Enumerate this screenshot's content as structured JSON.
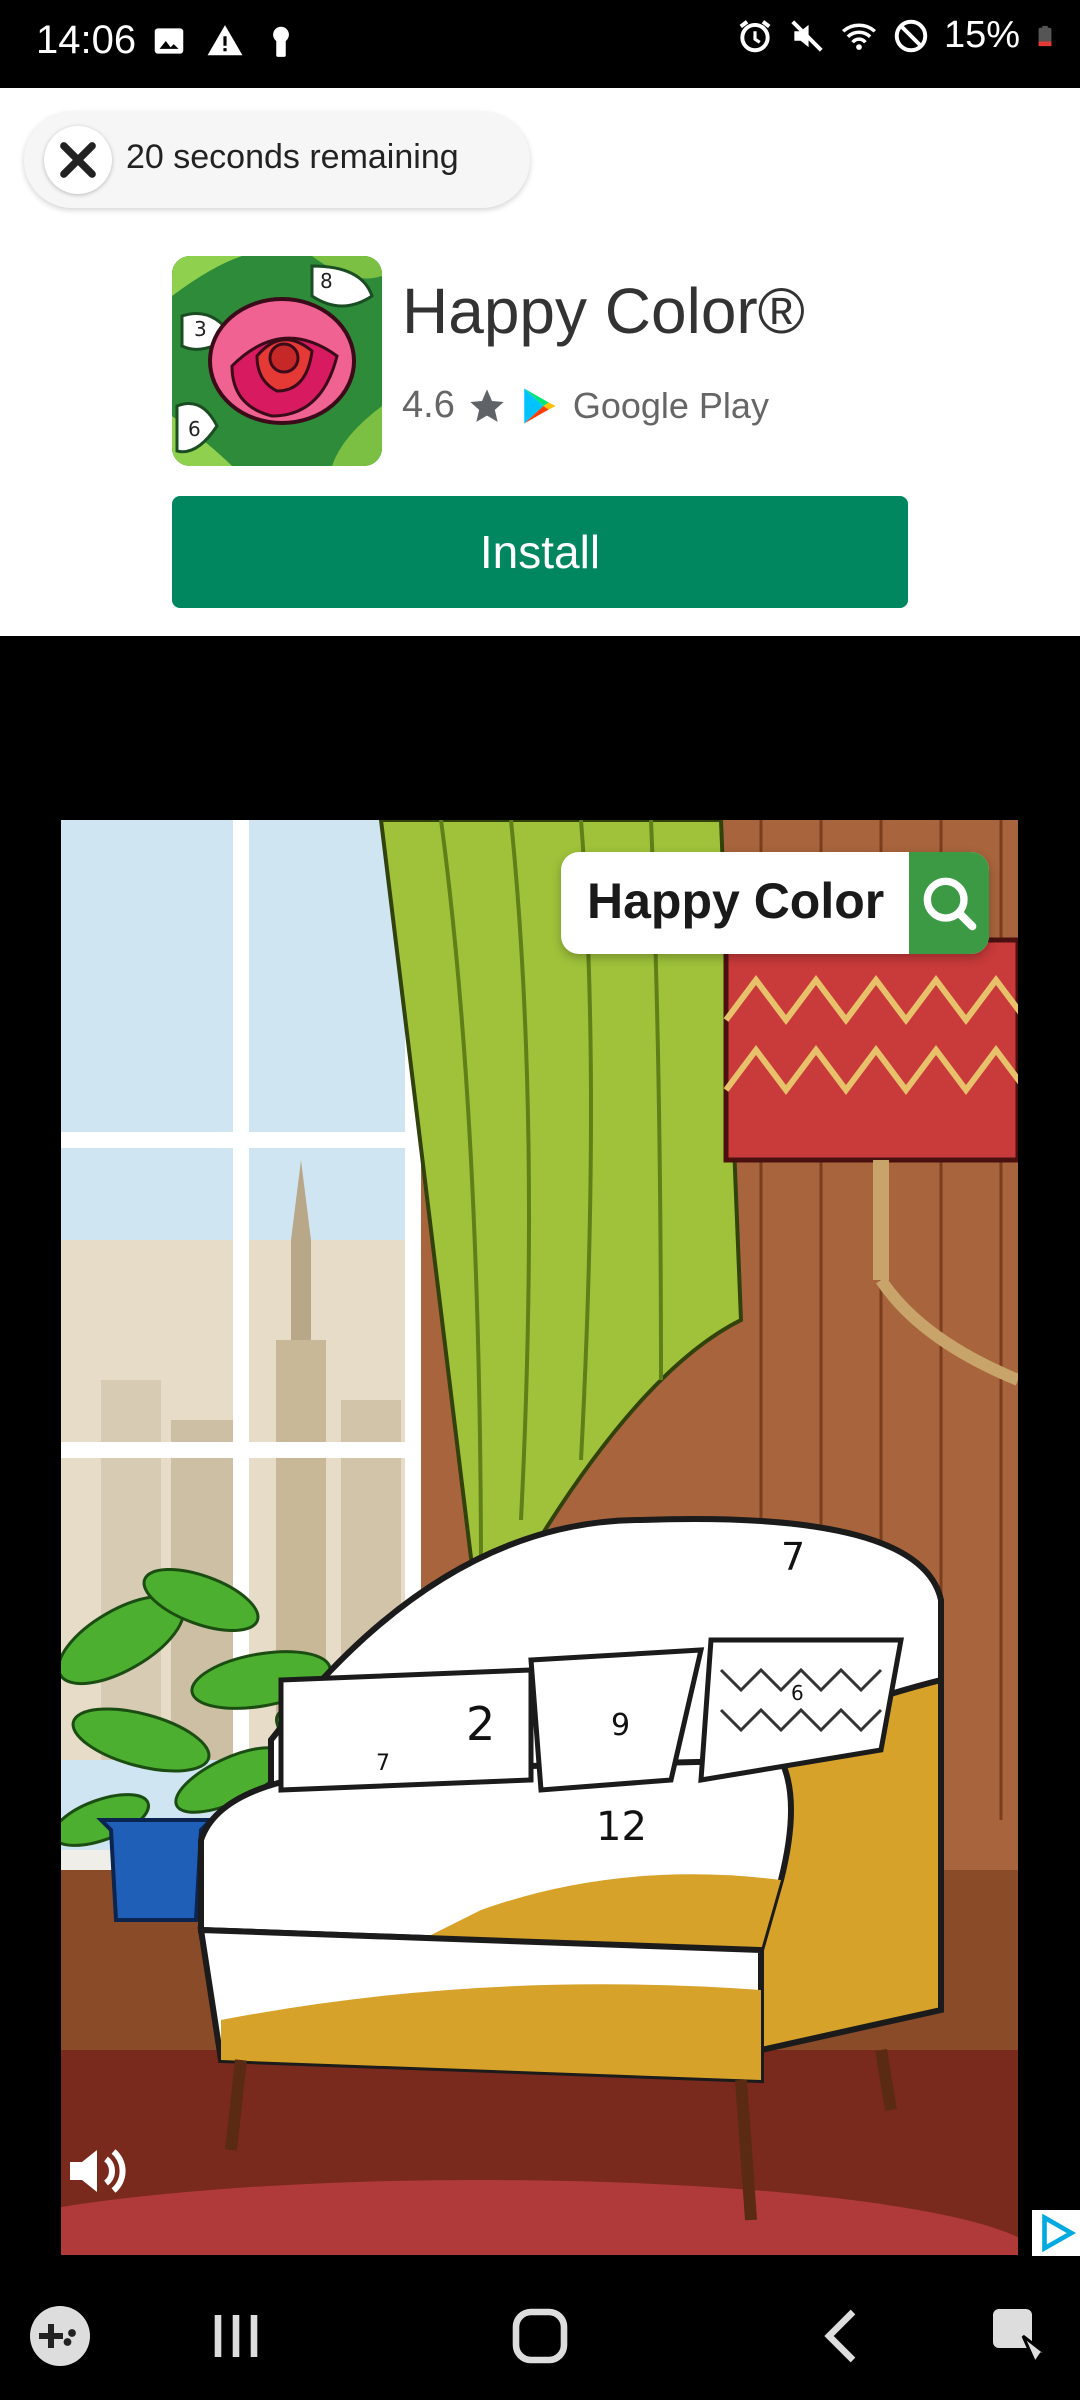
{
  "status_bar": {
    "time": "14:06",
    "battery": "15%"
  },
  "ad": {
    "countdown": "20 seconds remaining",
    "app_name": "Happy Color®",
    "rating": "4.6",
    "store": "Google Play",
    "install_label": "Install"
  },
  "creative": {
    "search_text": "Happy Color",
    "numbers": [
      "7",
      "2",
      "9",
      "6",
      "7",
      "12"
    ]
  },
  "colors": {
    "install_green": "#01875f",
    "search_green": "#3c9a45"
  }
}
